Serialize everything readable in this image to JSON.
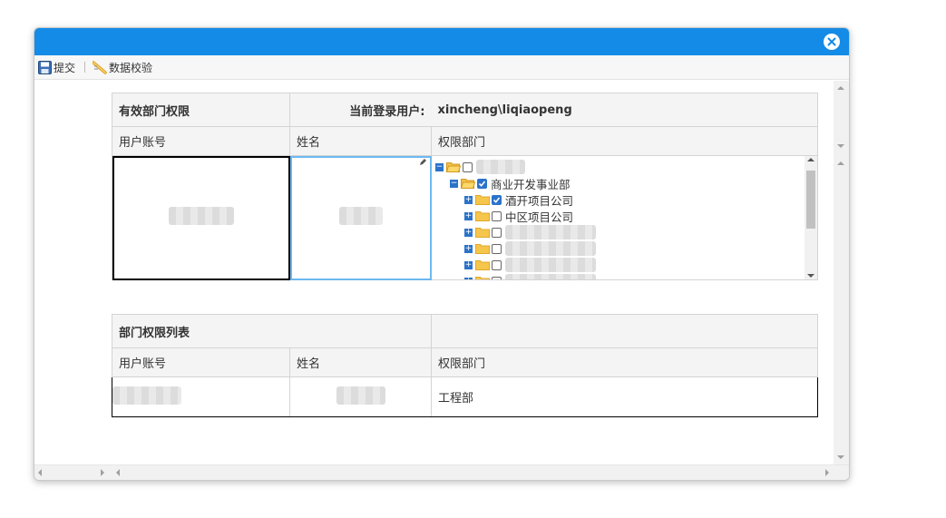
{
  "toolbar": {
    "submit_label": "提交",
    "validate_label": "数据校验"
  },
  "section1": {
    "title": "有效部门权限",
    "current_user_label": "当前登录用户:",
    "current_user_value": "xincheng\\liqiaopeng",
    "columns": [
      "用户账号",
      "姓名",
      "权限部门"
    ]
  },
  "tree": {
    "nodes": [
      {
        "label": "",
        "level": 0,
        "expanded": true,
        "checked": false
      },
      {
        "label": "商业开发事业部",
        "level": 1,
        "expanded": true,
        "checked": true
      },
      {
        "label": "酒开项目公司",
        "level": 2,
        "expanded": false,
        "checked": true
      },
      {
        "label": "中区项目公司",
        "level": 2,
        "expanded": false,
        "checked": false
      },
      {
        "label": "",
        "level": 2,
        "expanded": false,
        "checked": false
      },
      {
        "label": "",
        "level": 2,
        "expanded": false,
        "checked": false
      },
      {
        "label": "",
        "level": 2,
        "expanded": false,
        "checked": false
      },
      {
        "label": "",
        "level": 2,
        "expanded": false,
        "checked": false
      }
    ]
  },
  "section2": {
    "title": "部门权限列表",
    "columns": [
      "用户账号",
      "姓名",
      "权限部门"
    ],
    "rows": [
      {
        "account": "",
        "name": "",
        "department": "工程部"
      }
    ]
  },
  "colors": {
    "titlebar": "#148be6",
    "accent": "#2b73c9"
  }
}
